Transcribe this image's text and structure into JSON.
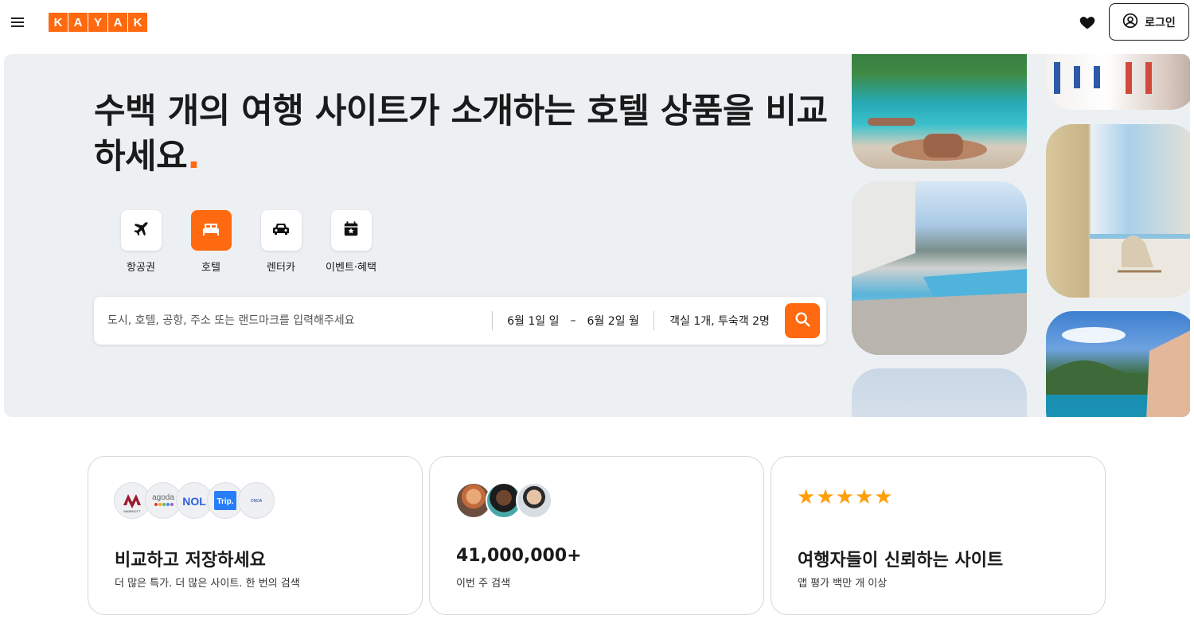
{
  "header": {
    "logo_letters": [
      "K",
      "A",
      "Y",
      "A",
      "K"
    ],
    "login_label": "로그인",
    "icons": {
      "menu": "hamburger-menu-icon",
      "heart": "heart-icon",
      "user": "user-circle-icon"
    }
  },
  "hero": {
    "title": "수백 개의 여행 사이트가 소개하는 호텔 상품을 비교하세요",
    "title_dot": ".",
    "tabs": [
      {
        "label": "항공권",
        "icon": "airplane-icon",
        "active": false
      },
      {
        "label": "호텔",
        "icon": "bed-icon",
        "active": true
      },
      {
        "label": "렌터카",
        "icon": "car-icon",
        "active": false
      },
      {
        "label": "이벤트·혜택",
        "icon": "calendar-star-icon",
        "active": false
      }
    ],
    "search": {
      "destination_placeholder": "도시, 호텔, 공항, 주소 또는 랜드마크를 입력해주세요",
      "destination_value": "",
      "checkin": "6월 1일 일",
      "date_separator": "–",
      "checkout": "6월 2일 월",
      "guests": "객실 1개, 투숙객 2명"
    }
  },
  "features": [
    {
      "title": "비교하고 저장하세요",
      "subtitle": "더 많은 특가. 더 많은 사이트. 한 번의 검색"
    },
    {
      "title": "41,000,000+",
      "subtitle": "이번 주 검색"
    },
    {
      "title": "여행자들이 신뢰하는 사이트",
      "subtitle": "앱 평가 백만 개 이상",
      "stars": 5
    }
  ],
  "partner_logos": {
    "marriott": "MARRIOTT",
    "agoda": "agoda",
    "nol": "NOL",
    "trip": "Trip.",
    "onda": "ONDA"
  },
  "colors": {
    "brand": "#ff690f",
    "hero_bg": "#edf0f3",
    "star": "#ff9f0a"
  }
}
